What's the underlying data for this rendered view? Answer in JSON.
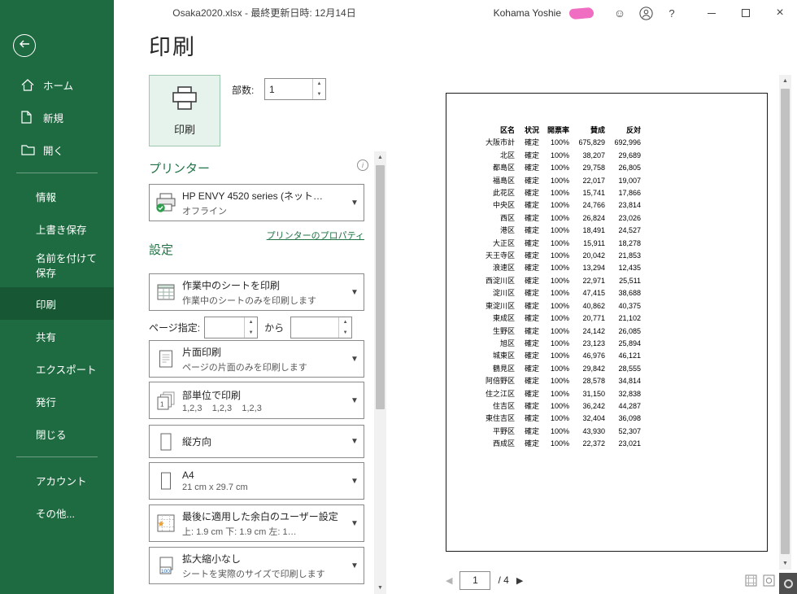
{
  "titlebar": {
    "document_title": "Osaka2020.xlsx - 最終更新日時: 12月14日",
    "user_name": "Kohama Yoshie",
    "help_label": "?"
  },
  "sidebar": {
    "items_top": [
      {
        "label": "ホーム"
      },
      {
        "label": "新規"
      },
      {
        "label": "開く"
      }
    ],
    "items_middle": [
      "情報",
      "上書き保存",
      "名前を付けて保存",
      "印刷",
      "共有",
      "エクスポート",
      "発行",
      "閉じる"
    ],
    "items_bottom": [
      "アカウント",
      "その他..."
    ],
    "selected_item": "印刷"
  },
  "main": {
    "page_title": "印刷",
    "print_button_label": "印刷",
    "copies_label": "部数:",
    "copies_value": "1",
    "printer": {
      "heading": "プリンター",
      "name": "HP ENVY 4520 series (ネット…",
      "status": "オフライン",
      "properties_link": "プリンターのプロパティ"
    },
    "settings": {
      "heading": "設定",
      "print_what": {
        "title": "作業中のシートを印刷",
        "subtitle": "作業中のシートのみを印刷します"
      },
      "pages_label": "ページ指定:",
      "pages_from_value": "",
      "pages_to_label": "から",
      "pages_to_value": "",
      "duplex": {
        "title": "片面印刷",
        "subtitle": "ページの片面のみを印刷します"
      },
      "collation": {
        "title": "部単位で印刷",
        "subtitle": "1,2,3    1,2,3    1,2,3"
      },
      "orientation": {
        "title": "縦方向"
      },
      "paper": {
        "title": "A4",
        "subtitle": "21 cm x 29.7 cm"
      },
      "margins": {
        "title": "最後に適用した余白のユーザー設定",
        "subtitle": "上: 1.9 cm 下: 1.9 cm 左: 1…"
      },
      "scaling": {
        "title": "拡大縮小なし",
        "subtitle": "シートを実際のサイズで印刷します",
        "icon_label": "100"
      }
    }
  },
  "preview": {
    "table": {
      "headers": [
        "区名",
        "状況",
        "開票率",
        "賛成",
        "反対"
      ],
      "rows": [
        [
          "大阪市計",
          "確定",
          "100%",
          "675,829",
          "692,996"
        ],
        [
          "北区",
          "確定",
          "100%",
          "38,207",
          "29,689"
        ],
        [
          "都島区",
          "確定",
          "100%",
          "29,758",
          "26,805"
        ],
        [
          "福島区",
          "確定",
          "100%",
          "22,017",
          "19,007"
        ],
        [
          "此花区",
          "確定",
          "100%",
          "15,741",
          "17,866"
        ],
        [
          "中央区",
          "確定",
          "100%",
          "24,766",
          "23,814"
        ],
        [
          "西区",
          "確定",
          "100%",
          "26,824",
          "23,026"
        ],
        [
          "港区",
          "確定",
          "100%",
          "18,491",
          "24,527"
        ],
        [
          "大正区",
          "確定",
          "100%",
          "15,911",
          "18,278"
        ],
        [
          "天王寺区",
          "確定",
          "100%",
          "20,042",
          "21,853"
        ],
        [
          "浪速区",
          "確定",
          "100%",
          "13,294",
          "12,435"
        ],
        [
          "西淀川区",
          "確定",
          "100%",
          "22,971",
          "25,511"
        ],
        [
          "淀川区",
          "確定",
          "100%",
          "47,415",
          "38,688"
        ],
        [
          "東淀川区",
          "確定",
          "100%",
          "40,862",
          "40,375"
        ],
        [
          "東成区",
          "確定",
          "100%",
          "20,771",
          "21,102"
        ],
        [
          "生野区",
          "確定",
          "100%",
          "24,142",
          "26,085"
        ],
        [
          "旭区",
          "確定",
          "100%",
          "23,123",
          "25,894"
        ],
        [
          "城東区",
          "確定",
          "100%",
          "46,976",
          "46,121"
        ],
        [
          "鶴見区",
          "確定",
          "100%",
          "29,842",
          "28,555"
        ],
        [
          "阿倍野区",
          "確定",
          "100%",
          "28,578",
          "34,814"
        ],
        [
          "住之江区",
          "確定",
          "100%",
          "31,150",
          "32,838"
        ],
        [
          "住吉区",
          "確定",
          "100%",
          "36,242",
          "44,287"
        ],
        [
          "東住吉区",
          "確定",
          "100%",
          "32,404",
          "36,098"
        ],
        [
          "平野区",
          "確定",
          "100%",
          "43,930",
          "52,307"
        ],
        [
          "西成区",
          "確定",
          "100%",
          "22,372",
          "23,021"
        ]
      ]
    },
    "nav": {
      "current_page": "1",
      "total_label": "/ 4"
    }
  }
}
